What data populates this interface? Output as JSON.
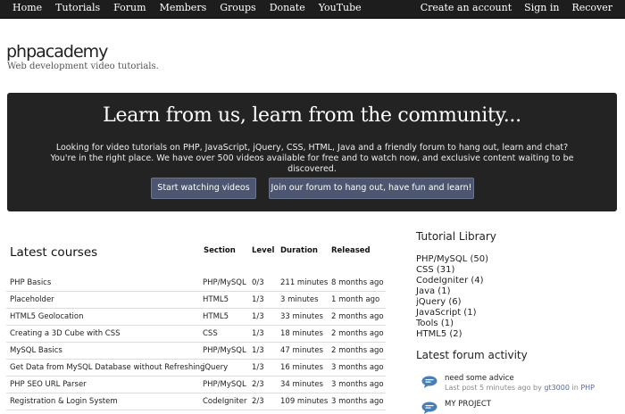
{
  "nav": {
    "left": [
      "Home",
      "Tutorials",
      "Forum",
      "Members",
      "Groups",
      "Donate",
      "YouTube"
    ],
    "right": [
      "Create an account",
      "Sign in",
      "Recover"
    ]
  },
  "header": {
    "logo": "phpacademy",
    "tagline": "Web development video tutorials."
  },
  "hero": {
    "title": "Learn from us, learn from the community...",
    "text": "Looking for video tutorials on PHP, JavaScript, jQuery, CSS, HTML, Java and a friendly forum to hang out, learn and chat? You're in the right place. We have over 500 videos available for free and to watch now, and exclusive content waiting to be discovered.",
    "watch_button": "Start watching videos",
    "forum_button": "Join our forum to hang out, have fun and learn!"
  },
  "courses": {
    "title": "Latest courses",
    "headers": [
      "Section",
      "Level",
      "Duration",
      "Released"
    ],
    "rows": [
      [
        "PHP Basics",
        "PHP/MySQL",
        "0/3",
        "211 minutes",
        "8 months ago"
      ],
      [
        "Placeholder",
        "HTML5",
        "1/3",
        "3 minutes",
        "1 month ago"
      ],
      [
        "HTML5 Geolocation",
        "HTML5",
        "1/3",
        "33 minutes",
        "2 months ago"
      ],
      [
        "Creating a 3D Cube with CSS",
        "CSS",
        "1/3",
        "18 minutes",
        "2 months ago"
      ],
      [
        "MySQL Basics",
        "PHP/MySQL",
        "1/3",
        "47 minutes",
        "2 months ago"
      ],
      [
        "Get Data from MySQL Database without Refreshing",
        "jQuery",
        "1/3",
        "16 minutes",
        "3 months ago"
      ],
      [
        "PHP SEO URL Parser",
        "PHP/MySQL",
        "2/3",
        "34 minutes",
        "3 months ago"
      ],
      [
        "Registration & Login System",
        "CodeIgniter",
        "2/3",
        "109 minutes",
        "3 months ago"
      ]
    ]
  },
  "library": {
    "title": "Tutorial Library",
    "items": [
      "PHP/MySQL (50)",
      "CSS (31)",
      "CodeIgniter (4)",
      "Java (1)",
      "jQuery (6)",
      "JavaScript (1)",
      "Tools (1)",
      "HTML5 (2)"
    ]
  },
  "forum": {
    "title": "Latest forum activity",
    "posts": [
      {
        "topic": "need some advice",
        "meta_prefix": "Last post 5 minutes ago by",
        "user": "gt3000",
        "meta_mid": "in",
        "section": "PHP"
      },
      {
        "topic": "MY PROJECT"
      }
    ]
  },
  "colors": {
    "nav_bg": "#1d1d1d",
    "hero_bg": "#232323",
    "button_bg": "#4c5670"
  }
}
